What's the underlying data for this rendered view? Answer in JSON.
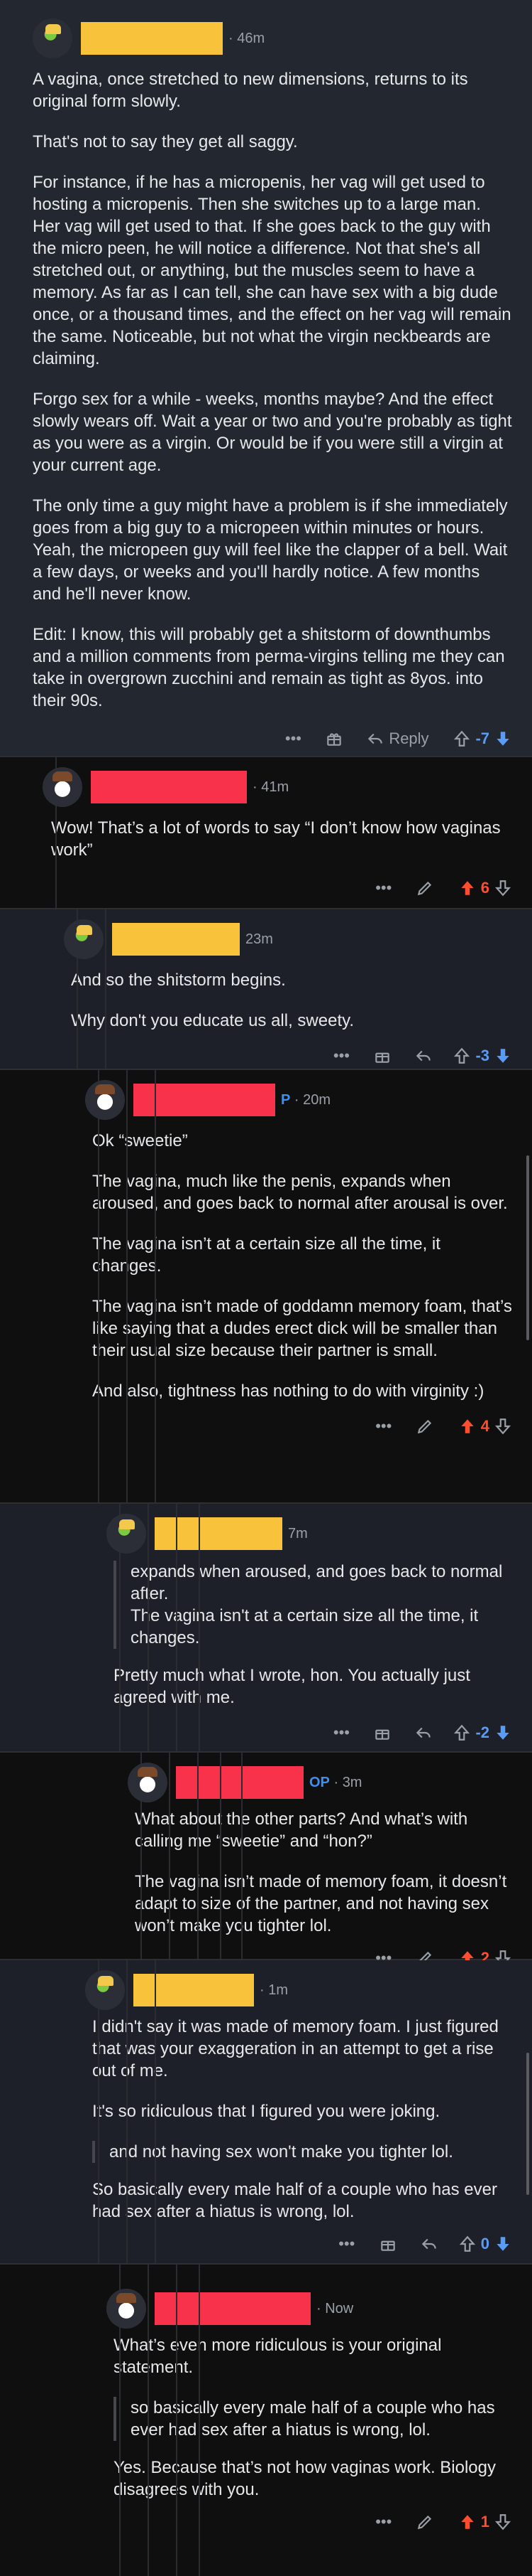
{
  "comments": [
    {
      "time": "46m",
      "paragraphs": [
        "A vagina, once stretched to new dimensions, returns to its original form slowly.",
        "That's not to say they get all saggy.",
        "For instance, if he has a micropenis, her vag will get used to hosting a micropenis.  Then she switches up to a large man.  Her vag will get used to that.  If she goes back to the guy with the micro peen, he will notice a difference.  Not that she's all stretched out, or anything, but the muscles seem to have a memory.  As far as I can tell, she can have sex with a big dude once, or a thousand times, and the effect on her vag will remain the same.  Noticeable, but not what the virgin neckbeards are claiming.",
        "Forgo sex for a while - weeks, months maybe?  And the effect slowly wears off.  Wait a year or two and you're probably as tight as you were as a virgin.  Or would be if you were still a virgin at your current age.",
        "The only time a guy might have a problem is if she immediately goes from a big guy to a micropeen within minutes or hours.  Yeah, the micropeen guy will feel like the clapper of a bell.  Wait a few days, or weeks and you'll hardly notice.  A few months and he'll never know.",
        "Edit: I know, this will probably get a shitstorm of downthumbs and a million comments from perma-virgins telling me they can take in overgrown zucchini and remain as tight as 8yos. into their 90s."
      ],
      "reply_label": "Reply",
      "score": "-7"
    },
    {
      "time": "41m",
      "paragraphs": [
        "Wow! That’s a lot of words to say “I don’t know how vaginas work”"
      ],
      "score": "6"
    },
    {
      "time": "23m",
      "paragraphs": [
        "And so the shitstorm begins.",
        "Why don't you educate us all, sweety."
      ],
      "score": "-3"
    },
    {
      "time": "20m",
      "op_fragment": "P",
      "paragraphs": [
        "Ok “sweetie”",
        "The vagina, much like the penis, expands when aroused, and goes back to normal after arousal is over.",
        "The vagina isn’t at a certain size all the time, it changes.",
        "The vagina isn’t made of goddamn memory foam, that’s like saying that a dudes erect dick will be smaller than their usual size because their partner is small.",
        "And also, tightness has nothing to do with virginity :)"
      ],
      "score": "4"
    },
    {
      "time": "7m",
      "quote": "expands when aroused, and goes back to normal after.\nThe vagina isn't at a certain size all the time, it changes.",
      "paragraphs": [
        "Pretty much what I wrote, hon.  You actually just agreed with me."
      ],
      "score": "-2"
    },
    {
      "time": "3m",
      "op_label": "OP",
      "paragraphs": [
        "What about the other parts? And what’s with calling me “sweetie” and “hon?”",
        "The vagina isn’t made of memory foam, it doesn’t adapt to size of the partner, and not having sex won’t make you tighter lol."
      ],
      "score": "2"
    },
    {
      "time": "1m",
      "paragraphs": [
        "I didn't say it was made of memory foam.  I just figured that was your exaggeration in an attempt to get a rise out of me.",
        "It's so ridiculous that I figured you were joking."
      ],
      "quote": "and not having sex won't make you tighter lol.",
      "after": [
        "So basically every male half of a couple who has ever had sex after a hiatus is wrong, lol."
      ],
      "score": "0"
    },
    {
      "time": "Now",
      "paragraphs": [
        "What’s even more ridiculous is your original statement."
      ],
      "quote": "so basically every male half of a couple who has ever had sex after a hiatus is wrong, lol.",
      "after": [
        "Yes. Because that’s not how vaginas work. Biology disagrees with you."
      ],
      "score": "1"
    }
  ],
  "colors": {
    "upvote": "#ff4d2d",
    "downvote": "#5a9cf5",
    "op": "#3f8ef2",
    "redact_yellow": "#f8c33b",
    "redact_red": "#f7324a"
  }
}
